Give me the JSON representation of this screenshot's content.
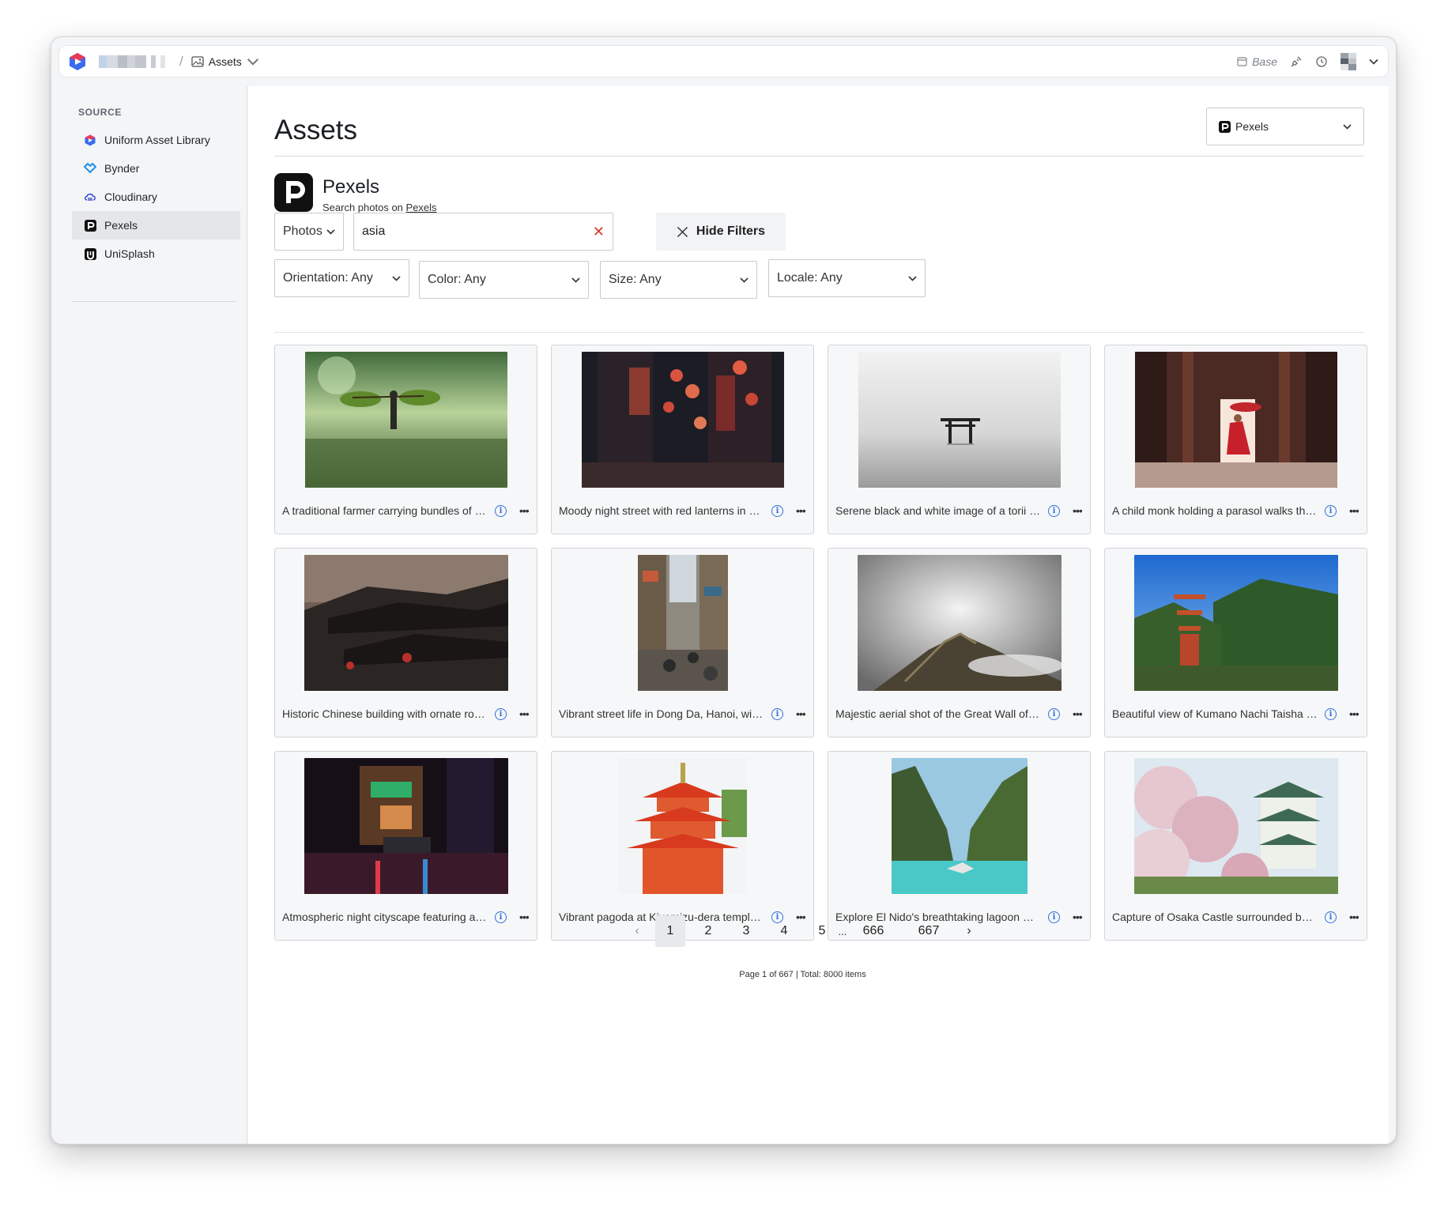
{
  "topbar": {
    "breadcrumb_label": "Assets",
    "base_label": "Base"
  },
  "sidebar": {
    "title": "SOURCE",
    "items": [
      {
        "label": "Uniform Asset Library",
        "icon": "uniform-logo-icon"
      },
      {
        "label": "Bynder",
        "icon": "bynder-logo-icon"
      },
      {
        "label": "Cloudinary",
        "icon": "cloudinary-logo-icon"
      },
      {
        "label": "Pexels",
        "icon": "pexels-logo-icon",
        "active": true
      },
      {
        "label": "UniSplash",
        "icon": "unisplash-logo-icon"
      }
    ]
  },
  "main": {
    "title": "Assets",
    "source_select": "Pexels",
    "provider": {
      "name": "Pexels",
      "subtitle": "Search photos on",
      "link": "Pexels"
    },
    "media_type": "Photos",
    "search_value": "asia",
    "hide_filters_label": "Hide Filters",
    "filters": {
      "orientation": "Orientation: Any",
      "color": "Color: Any",
      "size": "Size: Any",
      "locale": "Locale: Any"
    },
    "assets": [
      {
        "caption": "A traditional farmer carrying bundles of rice seedlings through a misty field"
      },
      {
        "caption": "Moody night street with red lanterns in an alley"
      },
      {
        "caption": "Serene black and white image of a torii gate standing in calm water"
      },
      {
        "caption": "A child monk holding a parasol walks through a wooden corridor"
      },
      {
        "caption": "Historic Chinese building with ornate roofs and red lanterns"
      },
      {
        "caption": "Vibrant street life in Dong Da, Hanoi, with motorbikes"
      },
      {
        "caption": "Majestic aerial shot of the Great Wall of China amid clouds"
      },
      {
        "caption": "Beautiful view of Kumano Nachi Taisha pagoda and mountains"
      },
      {
        "caption": "Atmospheric night cityscape featuring a neon lit street"
      },
      {
        "caption": "Vibrant pagoda at Kiyomizu-dera temple in Kyoto"
      },
      {
        "caption": "Explore El Nido's breathtaking lagoon with a boat"
      },
      {
        "caption": "Capture of Osaka Castle surrounded by cherry blossoms"
      }
    ],
    "pagination": {
      "prev": "‹",
      "pages": [
        "1",
        "2",
        "3",
        "4",
        "5"
      ],
      "ellipsis": "...",
      "tail_pages": [
        "666",
        "667"
      ],
      "next": "›",
      "current": "1",
      "info": "Page 1 of 667 | Total: 8000 items"
    }
  },
  "colors": {
    "accent": "#2f6fdc",
    "danger": "#d8342c",
    "active_item_bg": "#e4e6e9"
  }
}
